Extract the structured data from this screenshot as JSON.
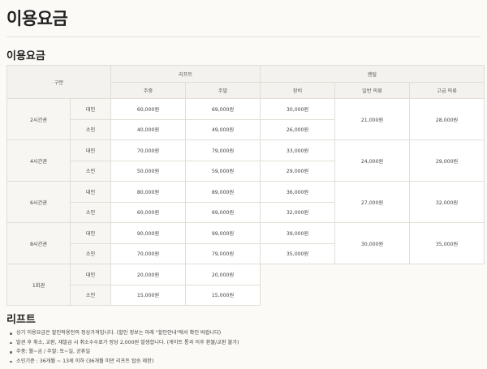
{
  "page_title": "이용요금",
  "price_section": {
    "title": "이용요금",
    "header": {
      "category": "구분",
      "lift": "리프트",
      "rental": "렌탈",
      "lift_cols": [
        "주중",
        "주말"
      ],
      "rental_cols": [
        "장비",
        "일반 의류",
        "고급 의류"
      ]
    },
    "rows": [
      {
        "group": "2시간권",
        "adult_label": "대인",
        "child_label": "소인",
        "adult": [
          "60,000원",
          "69,000원",
          "30,000원"
        ],
        "child": [
          "40,000원",
          "49,000원",
          "26,000원"
        ],
        "clothing_regular": "21,000원",
        "clothing_premium": "28,000원"
      },
      {
        "group": "4시간권",
        "adult_label": "대인",
        "child_label": "소인",
        "adult": [
          "70,000원",
          "79,000원",
          "33,000원"
        ],
        "child": [
          "50,000원",
          "59,000원",
          "29,000원"
        ],
        "clothing_regular": "24,000원",
        "clothing_premium": "29,000원"
      },
      {
        "group": "6시간권",
        "adult_label": "대인",
        "child_label": "소인",
        "adult": [
          "80,000원",
          "89,000원",
          "36,000원"
        ],
        "child": [
          "60,000원",
          "69,000원",
          "32,000원"
        ],
        "clothing_regular": "27,000원",
        "clothing_premium": "32,000원"
      },
      {
        "group": "8시간권",
        "adult_label": "대인",
        "child_label": "소인",
        "adult": [
          "90,000원",
          "99,000원",
          "39,000원"
        ],
        "child": [
          "70,000원",
          "79,000원",
          "35,000원"
        ],
        "clothing_regular": "30,000원",
        "clothing_premium": "35,000원"
      },
      {
        "group": "1회권",
        "adult_label": "대인",
        "child_label": "소인",
        "adult": [
          "20,000원",
          "20,000원"
        ],
        "child": [
          "15,000원",
          "15,000원"
        ]
      }
    ]
  },
  "lift_section": {
    "title": "리프트",
    "notes": [
      "상기 이용요금은 할인적용전의 정상가격입니다. (할인 정보는 아래 \"할인안내\"에서 확인 바랍니다)",
      "발권 후 취소, 교환, 재발급 시 취소수수료가 장당 2,000원 발생합니다. (게이트 통과 이후 환불/교환 불가)",
      "주중: 월~금 / 주말: 토~일, 공휴일",
      "소인기준 : 36개월 ~ 13세 이하 (36개월 미만 리프트 탑승 제한)"
    ]
  }
}
